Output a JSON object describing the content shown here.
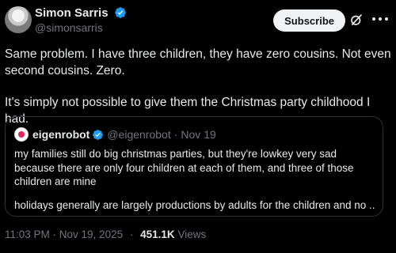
{
  "author": {
    "display_name": "Simon Sarris",
    "handle": "@simonsarris"
  },
  "actions": {
    "subscribe_label": "Subscribe"
  },
  "icons": {
    "verified": "verified-badge-icon",
    "grok": "grok-icon",
    "more": "more-options-icon"
  },
  "post": {
    "paragraph_1": "Same problem. I have three children, they have zero cousins. Not even second cousins. Zero.",
    "paragraph_2": "It's simply not possible to give them the Christmas party childhood I had."
  },
  "quote": {
    "display_name": "eigenrobot",
    "handle": "@eigenrobot",
    "separator": "·",
    "date": "Nov 19",
    "paragraph_1": "my families still do big christmas parties, but they're lowkey very sad because there are only four children at each of them, and three of those children are mine",
    "paragraph_2": "holidays generally are largely productions by adults for the children and no ..."
  },
  "meta": {
    "timestamp": "11:03 PM · Nov 19, 2025",
    "separator": "·",
    "views_count": "451.1K",
    "views_label": "Views"
  },
  "colors": {
    "background": "#000000",
    "text": "#e7e9ea",
    "muted": "#71767b",
    "verified": "#1d9bf0",
    "border": "#2f3336"
  }
}
